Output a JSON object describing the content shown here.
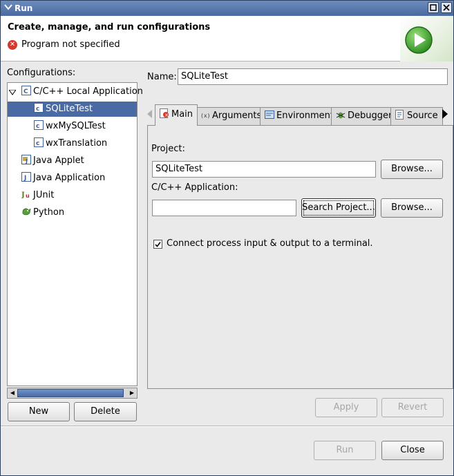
{
  "window": {
    "title": "Run"
  },
  "header": {
    "title": "Create, manage, and run configurations",
    "message": "Program not specified",
    "message_icon": "error-icon",
    "banner_icon": "run-play-icon"
  },
  "left": {
    "configurations_label": "Configurations:",
    "tree": {
      "root": {
        "label": "C/C++ Local Application",
        "expanded": true
      },
      "children": [
        "SQLiteTest",
        "wxMySQLTest",
        "wxTranslation"
      ],
      "selected": "SQLiteTest",
      "others": [
        "Java Applet",
        "Java Application",
        "JUnit",
        "Python"
      ]
    },
    "new_button": "New",
    "delete_button": "Delete"
  },
  "right": {
    "name_label": "Name:",
    "name_value": "SQLiteTest",
    "tabs": [
      "Main",
      "Arguments",
      "Environment",
      "Debugger",
      "Source"
    ],
    "active_tab": "Main",
    "project_label": "Project:",
    "project_value": "SQLiteTest",
    "browse_label": "Browse...",
    "app_label": "C/C++ Application:",
    "app_value": "",
    "search_project_label": "Search Project...",
    "terminal_checkbox_label": "Connect process input & output to a terminal.",
    "terminal_checked": true,
    "apply_button": "Apply",
    "revert_button": "Revert"
  },
  "footer": {
    "run_button": "Run",
    "close_button": "Close"
  },
  "colors": {
    "selection": "#4a6aa4",
    "titlebar": "#5a7ab0",
    "error": "#d6382b",
    "run_green": "#3aa02a"
  }
}
